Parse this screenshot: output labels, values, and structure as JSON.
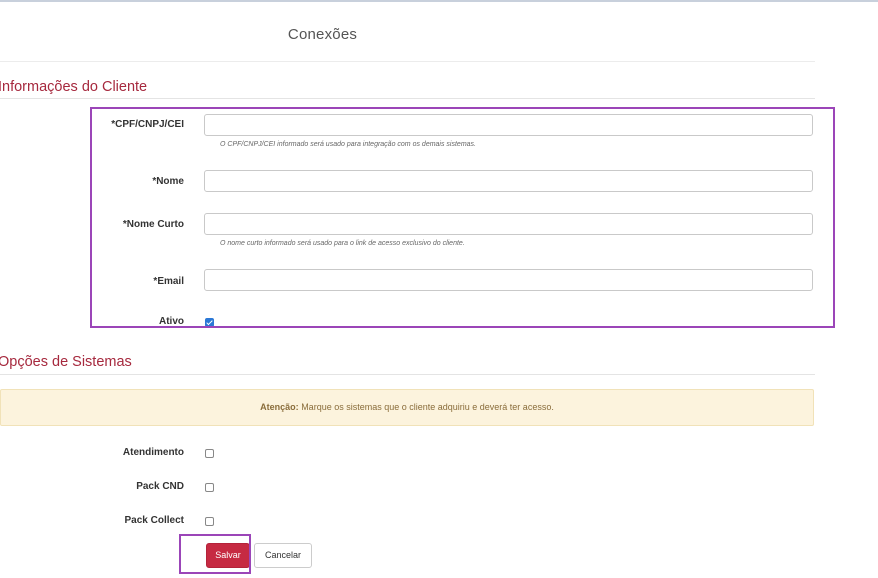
{
  "page": {
    "title": "Conexões"
  },
  "client_section": {
    "heading": "Informações do Cliente",
    "fields": {
      "cpf": {
        "label": "*CPF/CNPJ/CEI",
        "value": "",
        "help": "O CPF/CNPJ/CEI informado será usado para integração com os demais sistemas."
      },
      "nome": {
        "label": "*Nome",
        "value": ""
      },
      "nome_curto": {
        "label": "*Nome Curto",
        "value": "",
        "help": "O nome curto informado será usado para o link de acesso exclusivo do cliente."
      },
      "email": {
        "label": "*Email",
        "value": ""
      },
      "ativo": {
        "label": "Ativo",
        "checked": true
      }
    }
  },
  "systems_section": {
    "heading": "Opções de Sistemas",
    "alert": {
      "strong": "Atenção:",
      "text": " Marque os sistemas que o cliente adquiriu e deverá ter acesso."
    },
    "options": [
      {
        "label": "Atendimento",
        "checked": false
      },
      {
        "label": "Pack CND",
        "checked": false
      },
      {
        "label": "Pack Collect",
        "checked": false
      }
    ]
  },
  "actions": {
    "save_label": "Salvar",
    "cancel_label": "Cancelar"
  },
  "colors": {
    "accent": "#a6293e",
    "save_button": "#c62a42",
    "highlight": "#9b45b8",
    "alert_bg": "#fcf3dd",
    "checkbox_checked": "#2b78d6"
  }
}
